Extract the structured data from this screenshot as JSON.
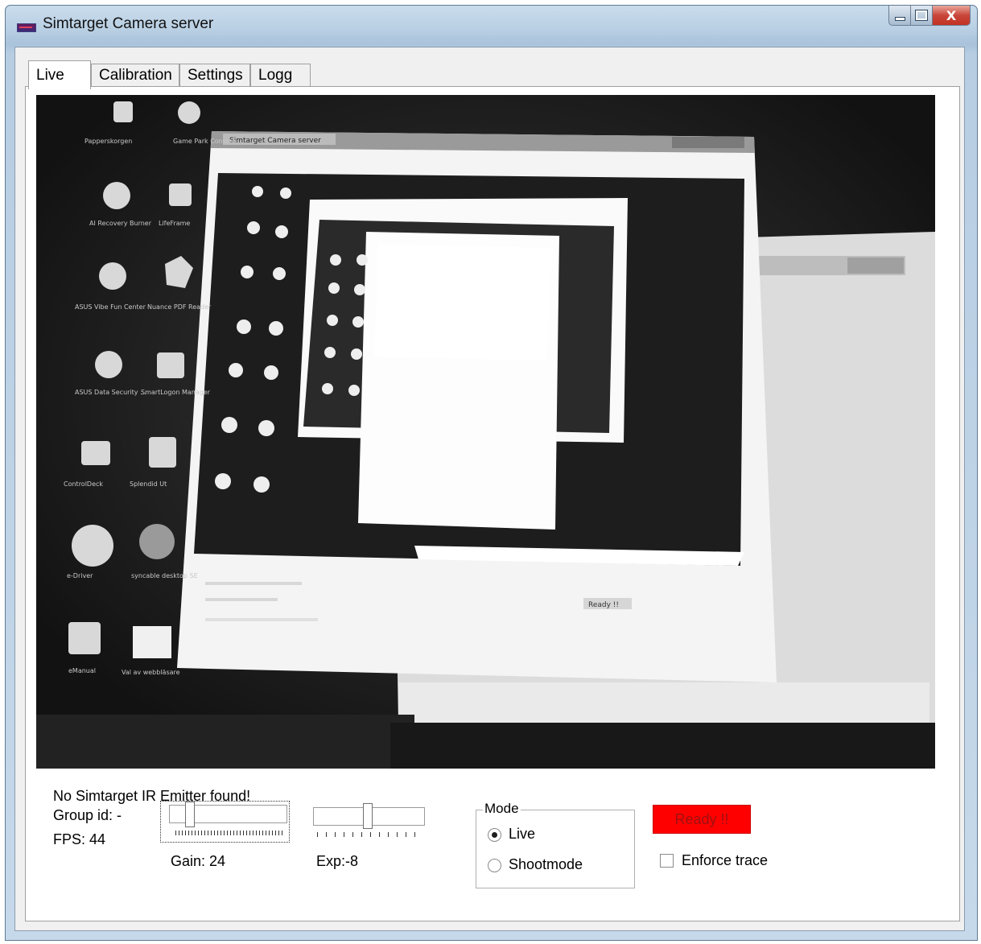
{
  "window": {
    "title": "Simtarget Camera server",
    "close_glyph": "X"
  },
  "tabs": [
    {
      "label": "Live",
      "active": true
    },
    {
      "label": "Calibration",
      "active": false
    },
    {
      "label": "Settings",
      "active": false
    },
    {
      "label": "Logg",
      "active": false
    }
  ],
  "status": {
    "emitter": "No Simtarget IR Emitter found!",
    "group_id": "Group id: -",
    "fps": "FPS: 44"
  },
  "gain": {
    "label": "Gain: 24"
  },
  "exposure": {
    "label": "Exp:-8"
  },
  "mode": {
    "legend": "Mode",
    "options": [
      {
        "label": "Live",
        "selected": true
      },
      {
        "label": "Shootmode",
        "selected": false
      }
    ]
  },
  "ready": {
    "label": "Ready !!",
    "color": "#ff0000"
  },
  "enforce_trace": {
    "label": "Enforce trace",
    "checked": false
  },
  "feed_texts": {
    "inner_title": "Simtarget Camera server",
    "inner_ready": "Ready !!",
    "desktop_icons": [
      "Papperskorgen",
      "Game Park Console",
      "AI Recovery Burner",
      "LifeFrame",
      "ASUS Vibe Fun Center",
      "Nuance PDF Reader",
      "ASUS Data Security ...",
      "SmartLogon Manager",
      "ControlDeck",
      "Splendid Ut",
      "e-Driver",
      "syncable desktop SE",
      "eManual",
      "Val av webbläsare"
    ]
  }
}
